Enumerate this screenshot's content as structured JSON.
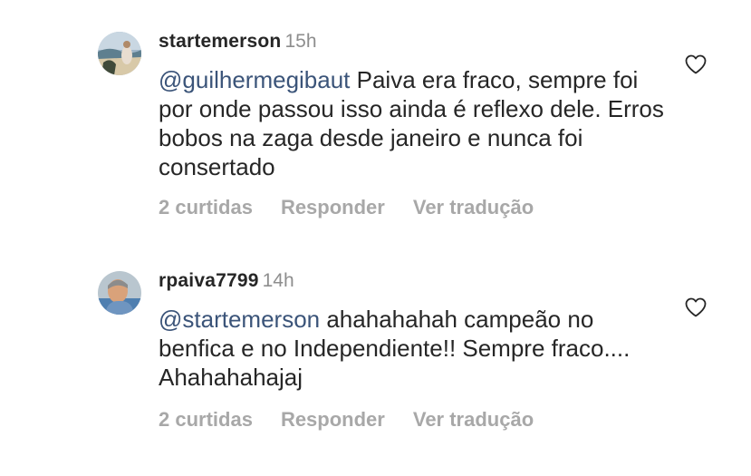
{
  "colors": {
    "text": "#262626",
    "secondary": "#8e8e8e",
    "action": "#a8a8a8",
    "mention": "#3b5479",
    "background": "#ffffff"
  },
  "comments": [
    {
      "username": "startemerson",
      "time": "15h",
      "mention": "@guilhermegibaut",
      "text": " Paiva era fraco, sempre foi por onde passou isso ainda é reflexo dele. Erros bobos na zaga desde janeiro e nunca foi consertado",
      "likes": "2 curtidas",
      "reply": "Responder",
      "translate": "Ver tradução",
      "avatar_icon": "profile-photo-beach",
      "like_icon": "heart-outline-icon"
    },
    {
      "username": "rpaiva7799",
      "time": "14h",
      "mention": "@startemerson",
      "text": " ahahahahah campeão no benfica e no Independiente!! Sempre fraco.... Ahahahahajaj",
      "likes": "2 curtidas",
      "reply": "Responder",
      "translate": "Ver tradução",
      "avatar_icon": "profile-photo-person",
      "like_icon": "heart-outline-icon"
    }
  ]
}
